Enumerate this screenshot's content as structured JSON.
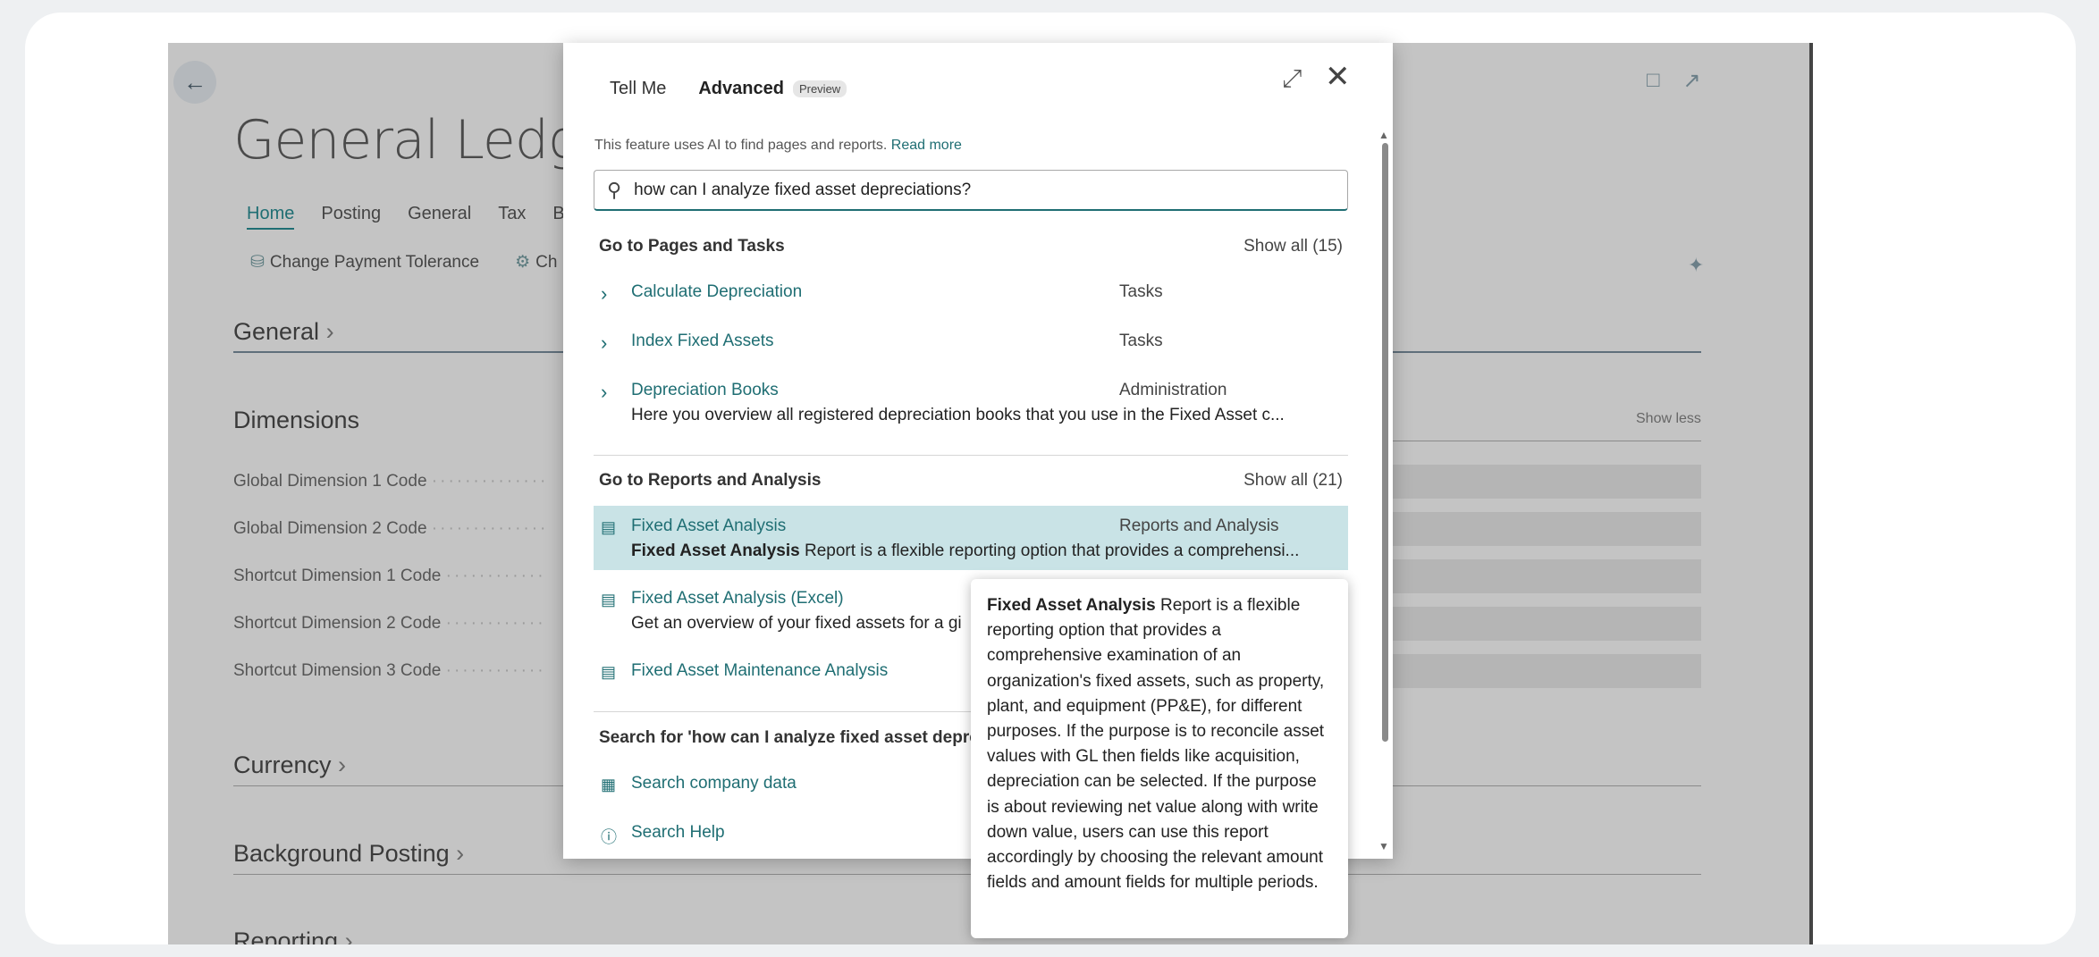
{
  "page": {
    "title": "General Ledger",
    "tabs": [
      "Home",
      "Posting",
      "General",
      "Tax",
      "Ba"
    ],
    "actions": [
      "Change Payment Tolerance",
      "Ch"
    ],
    "sections": {
      "general": "General",
      "dimensions": "Dimensions",
      "currency": "Currency",
      "background_posting": "Background Posting",
      "reporting": "Reporting"
    },
    "show_less": "Show less",
    "dimension_fields": [
      "Global Dimension 1 Code",
      "Global Dimension 2 Code",
      "Shortcut Dimension 1 Code",
      "Shortcut Dimension 2 Code",
      "Shortcut Dimension 3 Code"
    ]
  },
  "dialog": {
    "tab_tellme": "Tell Me",
    "tab_advanced": "Advanced",
    "preview_badge": "Preview",
    "ai_note": "This feature uses AI to find pages and reports.",
    "read_more": "Read more",
    "search_value": "how can I analyze fixed asset depreciations?",
    "pages_group": {
      "title": "Go to Pages and Tasks",
      "show_all": "Show all (15)",
      "items": [
        {
          "name": "Calculate Depreciation",
          "category": "Tasks"
        },
        {
          "name": "Index Fixed Assets",
          "category": "Tasks"
        },
        {
          "name": "Depreciation Books",
          "category": "Administration",
          "desc": "Here you overview all registered depreciation books that you use in the Fixed Asset c..."
        }
      ]
    },
    "reports_group": {
      "title": "Go to Reports and Analysis",
      "show_all": "Show all (21)",
      "items": [
        {
          "name": "Fixed Asset Analysis",
          "category": "Reports and Analysis",
          "desc_bold": "Fixed Asset Analysis",
          "desc": " Report is a flexible reporting option that provides a comprehensi..."
        },
        {
          "name": "Fixed Asset Analysis (Excel)",
          "desc": "Get an overview of your fixed assets for a gi"
        },
        {
          "name": "Fixed Asset Maintenance Analysis"
        }
      ]
    },
    "search_group": {
      "title": "Search for 'how can I analyze fixed asset depre",
      "items": [
        "Search company data",
        "Search Help"
      ]
    }
  },
  "tooltip": {
    "bold": "Fixed Asset Analysis",
    "text": " Report is a flexible reporting option that provides a comprehensive examination of an organization's fixed assets, such as property, plant, and equipment (PP&E), for different purposes. If the purpose is to reconcile asset values with GL then fields like acquisition, depreciation can be selected. If the purpose is about reviewing net value along with write down value, users can use this report accordingly by choosing the relevant amount fields and amount fields for multiple periods."
  },
  "colors": {
    "accent": "#1f6e73",
    "highlight": "#c9e3e6",
    "page_dim": "#c4c4c4"
  },
  "icons": [
    "back-arrow-icon",
    "bookmark-icon",
    "share-icon",
    "pin-icon",
    "expand-icon",
    "close-icon",
    "ai-search-icon",
    "chevron-right-icon",
    "report-doc-icon",
    "building-icon",
    "help-circle-icon"
  ]
}
